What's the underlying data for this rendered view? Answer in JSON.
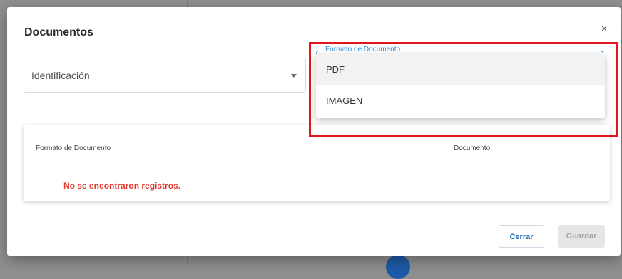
{
  "dialog": {
    "title": "Documentos",
    "close_glyph": "×"
  },
  "form": {
    "identificacion": {
      "label": "Identificación"
    },
    "formato_documento": {
      "label": "Formato de Documento",
      "options": [
        "PDF",
        "IMAGEN"
      ],
      "hovered_option": "PDF"
    }
  },
  "table": {
    "columns": [
      "Formato de Documento",
      "Documento"
    ],
    "empty_message": "No se encontraron registros."
  },
  "buttons": {
    "cerrar": "Cerrar",
    "guardar": "Guardar"
  },
  "colors": {
    "accent": "#2e8bd6",
    "error_text": "#e8352b",
    "highlight_box": "#e0161c"
  },
  "icons": [
    "close-icon",
    "chevron-down-icon"
  ]
}
